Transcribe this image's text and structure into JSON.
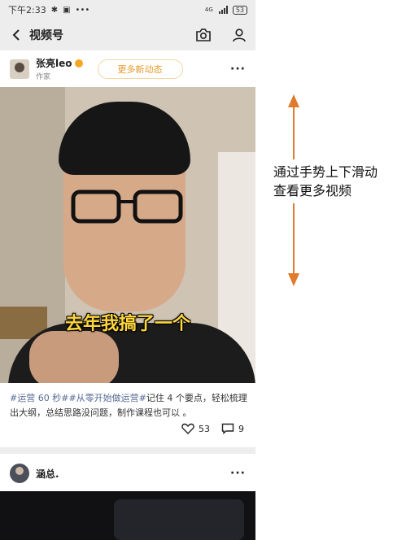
{
  "status_bar": {
    "time": "下午2:33",
    "left_icons": [
      "bluetooth-icon",
      "message-icon",
      "more-dots-icon"
    ],
    "network": "4G",
    "battery": "53"
  },
  "nav": {
    "title": "视频号",
    "back_icon": "back-arrow-icon",
    "camera_icon": "camera-icon",
    "profile_icon": "person-icon"
  },
  "post1": {
    "author_name": "张亮leo",
    "author_role": "作家",
    "more_button_label": "更多新动态",
    "menu": "···",
    "video_subtitle": "去年我搞了一个",
    "caption": {
      "tags": [
        "#运营 60 秒#",
        "#从零开始做运营#"
      ],
      "text": "记住 4 个要点，轻松梳理出大纲，总结思路没问题，制作课程也可以 。"
    },
    "likes": "53",
    "comments": "9"
  },
  "post2": {
    "author_name": "涵总.",
    "menu": "···"
  },
  "annotation": {
    "line1": "通过手势上下滑动",
    "line2": "查看更多视频",
    "arrow_color": "#e07a2c"
  },
  "colors": {
    "accent": "#e39a2b",
    "tag_link": "#576b95",
    "subtitle": "#ffd63b",
    "header_bg": "#ededed"
  }
}
